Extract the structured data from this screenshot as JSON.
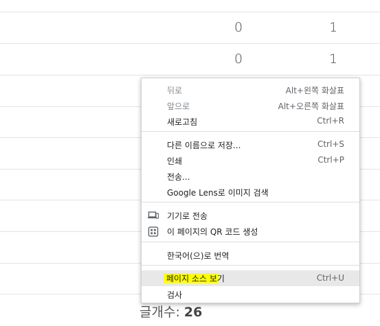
{
  "table": {
    "rows": [
      {
        "col1": "",
        "col2": ""
      },
      {
        "col1": "0",
        "col2": "1"
      },
      {
        "col1": "0",
        "col2": "1"
      }
    ]
  },
  "footer": {
    "label": "글개수:",
    "count": "26"
  },
  "context_menu": {
    "items": [
      {
        "label": "뒤로",
        "shortcut": "Alt+왼쪽 화살표",
        "disabled": true
      },
      {
        "label": "앞으로",
        "shortcut": "Alt+오른쪽 화살표",
        "disabled": true
      },
      {
        "label": "새로고침",
        "shortcut": "Ctrl+R"
      },
      {
        "label": "다른 이름으로 저장...",
        "shortcut": "Ctrl+S"
      },
      {
        "label": "인쇄",
        "shortcut": "Ctrl+P"
      },
      {
        "label": "전송...",
        "shortcut": ""
      },
      {
        "label": "Google Lens로 이미지 검색",
        "shortcut": ""
      },
      {
        "label": "기기로 전송",
        "shortcut": "",
        "icon": "devices-icon"
      },
      {
        "label": "이 페이지의 QR 코드 생성",
        "shortcut": "",
        "icon": "qr-code-icon"
      },
      {
        "label": "한국어(으)로 번역",
        "shortcut": ""
      },
      {
        "label": "페이지 소스 보기",
        "shortcut": "Ctrl+U",
        "highlighted": true
      },
      {
        "label": "검사",
        "shortcut": ""
      }
    ]
  },
  "colors": {
    "highlight": "#ffff00",
    "menu_hover": "#e8e8e8"
  }
}
